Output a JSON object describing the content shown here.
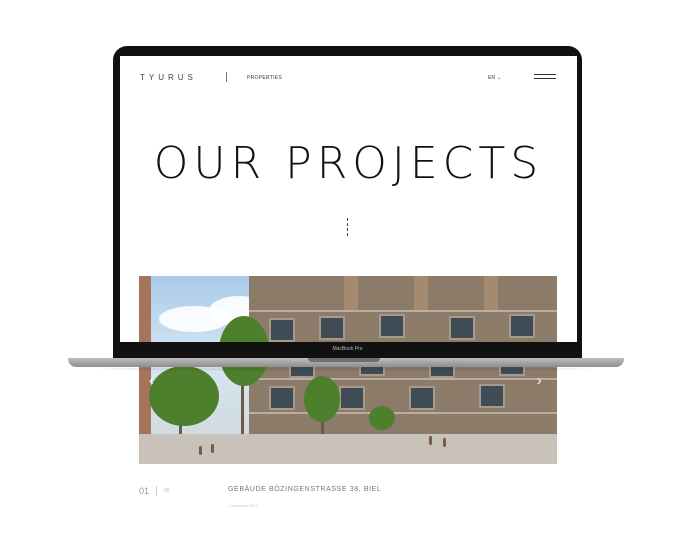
{
  "nav": {
    "logo": "TYURUS",
    "link_properties": "PROPERTIES",
    "language": "EN",
    "language_chevron": "⌄"
  },
  "hero": {
    "title": "OUR PROJECTS"
  },
  "device": {
    "label": "MacBook Pro"
  },
  "carousel": {
    "prev_arrow": "‹",
    "next_arrow": "›",
    "current": "01",
    "total": "05",
    "project_name": "GEBÄUDE BÖZINGENSTRASSE 38, BIEL",
    "project_meta": "Completed 2021"
  }
}
